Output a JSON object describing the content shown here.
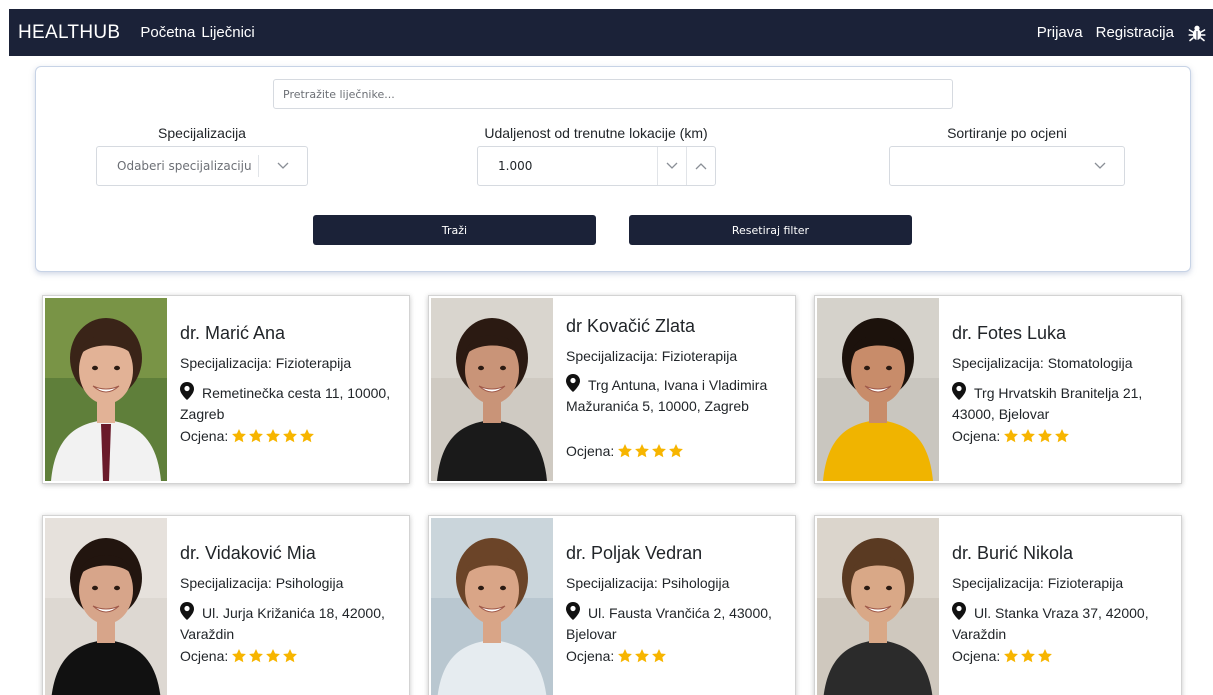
{
  "navbar": {
    "brand": "HEALTHUB",
    "links": [
      "Početna",
      "Liječnici"
    ],
    "right_links": [
      "Prijava",
      "Registracija"
    ],
    "bug_icon": "bug-icon"
  },
  "filters": {
    "search_placeholder": "Pretražite liječnike...",
    "specialization_label": "Specijalizacija",
    "specialization_value": "Odaberi specijalizaciju",
    "distance_label": "Udaljenost od trenutne lokacije (km)",
    "distance_value": "1.000",
    "sort_label": "Sortiranje po ocjeni",
    "sort_value": "",
    "search_button": "Traži",
    "reset_button": "Resetiraj filter"
  },
  "colors": {
    "navbar": "#1b2238",
    "star": "#f7b500",
    "panel_border": "#c7d3e6"
  },
  "doctors": [
    {
      "name": "dr. Marić Ana",
      "specialization": "Specijalizacija: Fizioterapija",
      "address": "Remetinečka cesta 11, 10000, Zagreb",
      "rating_label": "Ocjena:",
      "rating": 5
    },
    {
      "name": "dr Kovačić Zlata",
      "specialization": "Specijalizacija: Fizioterapija",
      "address": "Trg Antuna, Ivana i Vladimira Mažuranića 5, 10000, Zagreb",
      "rating_label": "Ocjena:",
      "rating": 4
    },
    {
      "name": "dr. Fotes Luka",
      "specialization": "Specijalizacija: Stomatologija",
      "address": "Trg Hrvatskih Branitelja 21, 43000, Bjelovar",
      "rating_label": "Ocjena:",
      "rating": 4
    },
    {
      "name": "dr. Vidaković Mia",
      "specialization": "Specijalizacija: Psihologija",
      "address": "Ul. Jurja Križanića 18, 42000, Varaždin",
      "rating_label": "Ocjena:",
      "rating": 4
    },
    {
      "name": "dr. Poljak Vedran",
      "specialization": "Specijalizacija: Psihologija",
      "address": "Ul. Fausta Vrančića 2, 43000, Bjelovar",
      "rating_label": "Ocjena:",
      "rating": 3
    },
    {
      "name": "dr. Burić Nikola",
      "specialization": "Specijalizacija: Fizioterapija",
      "address": "Ul. Stanka Vraza 37, 42000, Varaždin",
      "rating_label": "Ocjena:",
      "rating": 3
    }
  ]
}
